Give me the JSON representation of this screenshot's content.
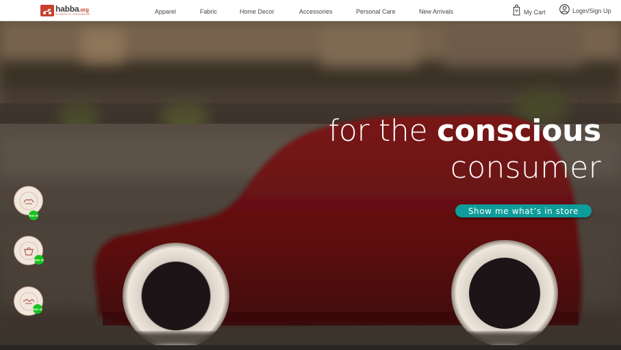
{
  "brand": {
    "name": "habba",
    "tld": ".org",
    "tagline": "HONESTLY HANDMADE"
  },
  "nav": {
    "items": [
      {
        "label": "Apparel"
      },
      {
        "label": "Fabric"
      },
      {
        "label": "Home Decor"
      },
      {
        "label": "Accessories"
      },
      {
        "label": "Personal Care"
      },
      {
        "label": "New Arrivals"
      }
    ]
  },
  "header": {
    "cart_label": "My Cart",
    "login_label": "Login/Sign Up"
  },
  "hero": {
    "line1_light": "for the ",
    "line1_bold": "conscious",
    "line2": "consumer",
    "cta_label": "Show me what’s in store"
  },
  "badges": [
    {
      "tag": "Hov er",
      "icon": "hands-icon"
    },
    {
      "tag": "Hov er",
      "icon": "basket-icon"
    },
    {
      "tag": "Hov er",
      "icon": "handshake-icon"
    }
  ],
  "colors": {
    "brand_red": "#c8402f",
    "accent_teal": "#0e9c9a",
    "badge_green": "#16c21f",
    "car_red": "#6e1212"
  }
}
